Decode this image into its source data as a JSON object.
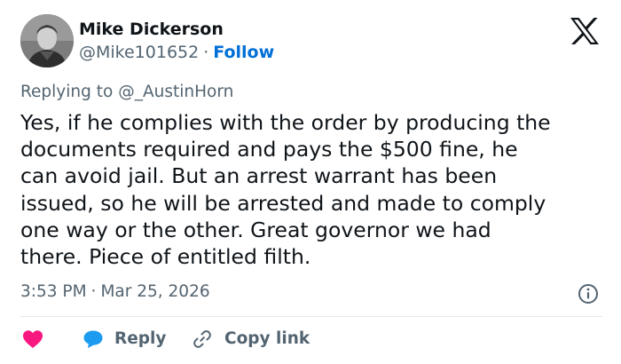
{
  "author": {
    "name": "Mike Dickerson",
    "handle": "@Mike101652",
    "separator": "·",
    "follow_label": "Follow"
  },
  "replying": {
    "prefix": "Replying to",
    "mention": "@_AustinHorn"
  },
  "tweet": {
    "text": "Yes, if he complies with the order by producing the\ndocuments required and pays the $500 fine, he\ncan avoid jail. But an arrest warrant has been\nissued, so he will be arrested and made to comply\none way or the other. Great governor we had\nthere. Piece of entitled filth."
  },
  "meta": {
    "time": "3:53 PM",
    "separator": "·",
    "date": "Mar 25, 2026"
  },
  "actions": {
    "reply_label": "Reply",
    "copy_label": "Copy link"
  },
  "icons": {
    "logo": "x-logo-icon",
    "info": "info-icon",
    "like": "heart-icon",
    "reply": "speech-bubble-icon",
    "copy": "link-icon"
  },
  "colors": {
    "text": "#0f1419",
    "secondary": "#536471",
    "link": "#006fd6",
    "heart": "#f91880",
    "reply_bubble": "#1d9bf0",
    "divider": "#e1e8ed"
  }
}
